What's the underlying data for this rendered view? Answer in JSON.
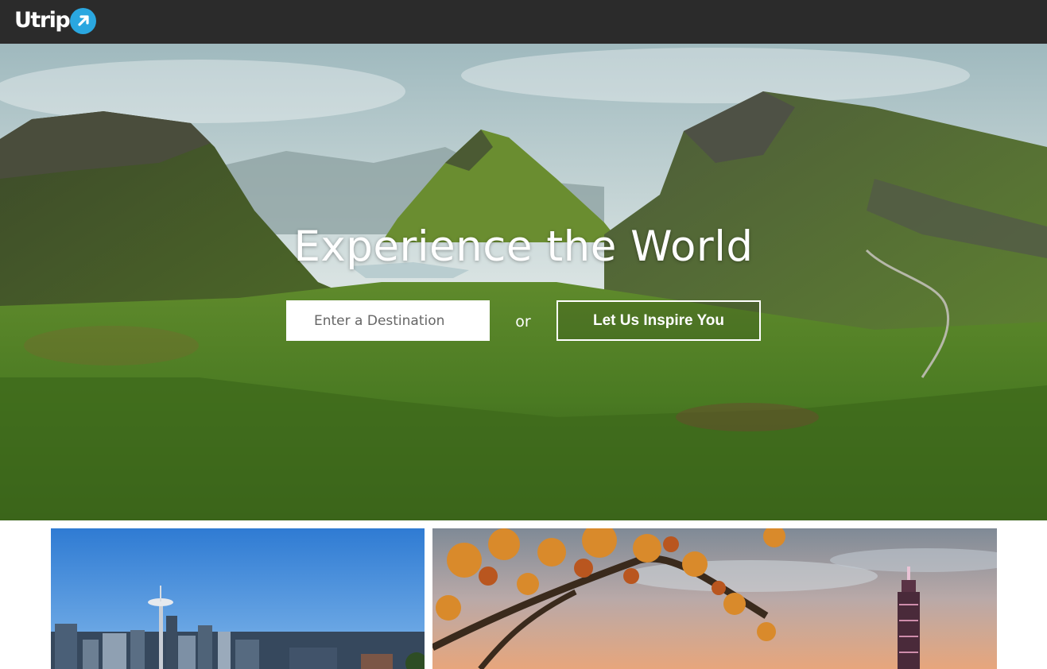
{
  "brand": {
    "name": "Utrip",
    "accent": "#2aa7e0",
    "header_bg": "#2b2b2b"
  },
  "hero": {
    "title": "Experience the World",
    "search_placeholder": "Enter a Destination",
    "search_value": "",
    "or_label": "or",
    "inspire_label": "Let Us Inspire You",
    "image": "green-mountain-valley-photo"
  },
  "cards": [
    {
      "image": "city-skyline-with-snowy-mountain-photo"
    },
    {
      "image": "autumn-leaves-tower-sunset-photo"
    }
  ]
}
